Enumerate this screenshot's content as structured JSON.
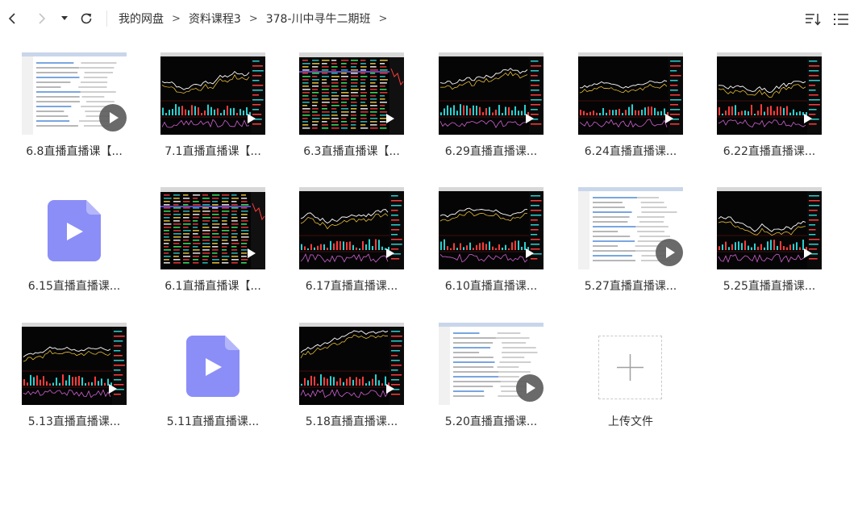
{
  "breadcrumb": {
    "items": [
      "我的网盘",
      "资料课程3",
      "378-川中寻牛二期班"
    ],
    "separator": ">"
  },
  "toolbar": {
    "back_icon": "chevron-left-icon",
    "forward_icon": "chevron-right-icon",
    "history_icon": "caret-down-icon",
    "refresh_icon": "refresh-icon",
    "sort_icon": "sort-icon",
    "view_icon": "list-view-icon"
  },
  "files": [
    {
      "name": "6.8直播直播课【...",
      "kind": "video",
      "style": "web"
    },
    {
      "name": "7.1直播直播课【...",
      "kind": "video",
      "style": "chart"
    },
    {
      "name": "6.3直播直播课【...",
      "kind": "video",
      "style": "table"
    },
    {
      "name": "6.29直播直播课...",
      "kind": "video",
      "style": "chart2"
    },
    {
      "name": "6.24直播直播课...",
      "kind": "video",
      "style": "chart3"
    },
    {
      "name": "6.22直播直播课...",
      "kind": "video",
      "style": "chart"
    },
    {
      "name": "6.15直播直播课...",
      "kind": "file"
    },
    {
      "name": "6.1直播直播课【...",
      "kind": "video",
      "style": "table"
    },
    {
      "name": "6.17直播直播课...",
      "kind": "video",
      "style": "chart2"
    },
    {
      "name": "6.10直播直播课...",
      "kind": "video",
      "style": "chart3"
    },
    {
      "name": "5.27直播直播课...",
      "kind": "video",
      "style": "web"
    },
    {
      "name": "5.25直播直播课...",
      "kind": "video",
      "style": "chart"
    },
    {
      "name": "5.13直播直播课...",
      "kind": "video",
      "style": "chart3"
    },
    {
      "name": "5.11直播直播课...",
      "kind": "file"
    },
    {
      "name": "5.18直播直播课...",
      "kind": "video",
      "style": "chart3"
    },
    {
      "name": "5.20直播直播课...",
      "kind": "video",
      "style": "web"
    }
  ],
  "upload": {
    "label": "上传文件",
    "icon": "plus-icon"
  },
  "colors": {
    "file_icon": "#8b8ef7",
    "play_badge": "#5a5a5a",
    "stock_red": "#ff3b3b",
    "stock_cyan": "#2ad0d0",
    "stock_yellow": "#ffd23a"
  }
}
